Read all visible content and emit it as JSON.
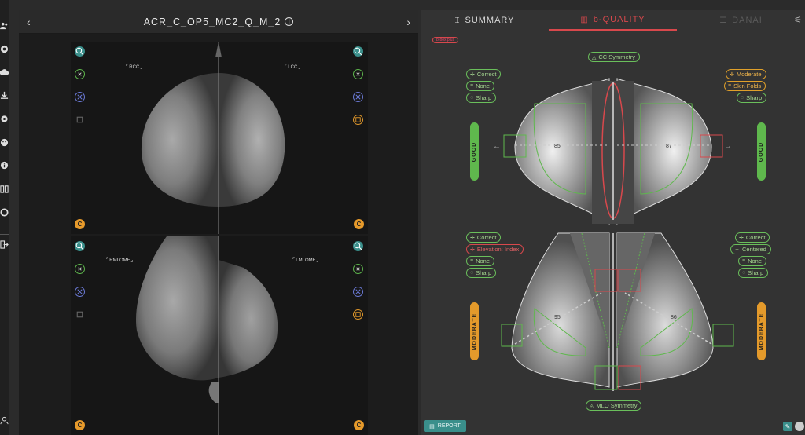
{
  "viewer": {
    "title": "ACR_C_OP5_MC2_Q_M_2",
    "info_icon": "i",
    "prev": "‹",
    "next": "›",
    "views": [
      {
        "label": "RCC",
        "badge": "C"
      },
      {
        "label": "LCC",
        "badge": "C"
      },
      {
        "label": "RMLOMF",
        "badge": "C"
      },
      {
        "label": "LMLOMF",
        "badge": "C"
      }
    ]
  },
  "tabs": [
    {
      "label": "SUMMARY",
      "icon": "summary-icon"
    },
    {
      "label": "b-QUALITY",
      "icon": "quality-icon"
    },
    {
      "label": "DANAI",
      "icon": "danai-icon"
    }
  ],
  "plus_badge": "b-box plus",
  "cc": {
    "symmetry": "CC Symmetry",
    "left_chips": [
      "Correct",
      "None",
      "Sharp"
    ],
    "right_chips": [
      "Moderate",
      "Skin Folds",
      "Sharp"
    ],
    "left_value": "85",
    "right_value": "87",
    "left_grade": "GOOD",
    "right_grade": "GOOD"
  },
  "mlo": {
    "symmetry": "MLO Symmetry",
    "left_chips": [
      "Correct",
      "Elevation: Index",
      "None",
      "Sharp"
    ],
    "right_chips": [
      "Correct",
      "Centered",
      "None",
      "Sharp"
    ],
    "left_value": "95",
    "right_value": "86",
    "left_grade": "MODERATE",
    "right_grade": "MODERATE"
  },
  "report_label": "REPORT",
  "colors": {
    "good": "#5fb84d",
    "moderate": "#e49a2b",
    "error": "#d8484c",
    "accent": "#3a8f8b"
  }
}
